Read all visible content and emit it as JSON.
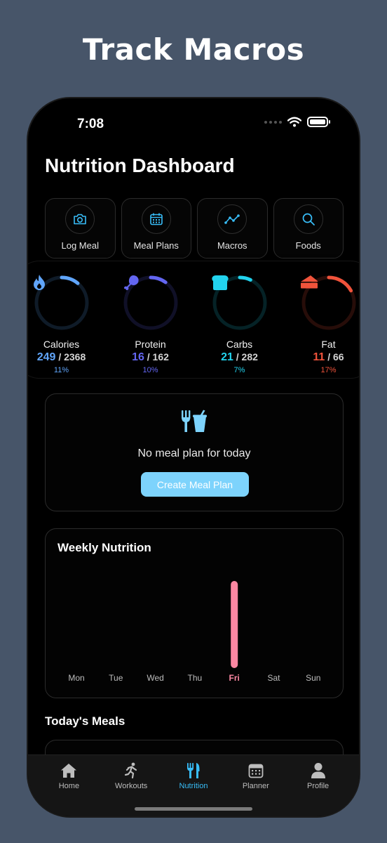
{
  "headline": "Track Macros",
  "status": {
    "time": "7:08"
  },
  "title": "Nutrition Dashboard",
  "quick_actions": [
    {
      "label": "Log Meal",
      "icon": "camera-icon"
    },
    {
      "label": "Meal Plans",
      "icon": "calendar-icon"
    },
    {
      "label": "Macros",
      "icon": "trend-icon"
    },
    {
      "label": "Foods",
      "icon": "search-icon"
    }
  ],
  "macros": [
    {
      "name": "Calories",
      "current": "249",
      "goal": "/ 2368",
      "percent": "11%",
      "progress": 0.11,
      "color": "#60a5fa",
      "icon": "flame-icon"
    },
    {
      "name": "Protein",
      "current": "16",
      "goal": "/ 162",
      "percent": "10%",
      "progress": 0.1,
      "color": "#6366f1",
      "icon": "drumstick-icon"
    },
    {
      "name": "Carbs",
      "current": "21",
      "goal": "/ 282",
      "percent": "7%",
      "progress": 0.07,
      "color": "#22d3ee",
      "icon": "bread-icon"
    },
    {
      "name": "Fat",
      "current": "11",
      "goal": "/ 66",
      "percent": "17%",
      "progress": 0.17,
      "color": "#f0533b",
      "icon": "cheese-icon"
    }
  ],
  "meal_plan": {
    "message": "No meal plan for today",
    "button": "Create Meal Plan"
  },
  "weekly": {
    "title": "Weekly Nutrition"
  },
  "chart_data": {
    "type": "bar",
    "categories": [
      "Mon",
      "Tue",
      "Wed",
      "Thu",
      "Fri",
      "Sat",
      "Sun"
    ],
    "values": [
      0,
      0,
      0,
      0,
      249,
      0,
      0
    ],
    "highlight": "Fri",
    "bar_color": "#fb87a2",
    "grid": false
  },
  "meals_title": "Today's Meals",
  "tabbar": [
    {
      "label": "Home",
      "icon": "home-icon",
      "active": false
    },
    {
      "label": "Workouts",
      "icon": "runner-icon",
      "active": false
    },
    {
      "label": "Nutrition",
      "icon": "utensils-icon",
      "active": true
    },
    {
      "label": "Planner",
      "icon": "planner-icon",
      "active": false
    },
    {
      "label": "Profile",
      "icon": "profile-icon",
      "active": false
    }
  ]
}
